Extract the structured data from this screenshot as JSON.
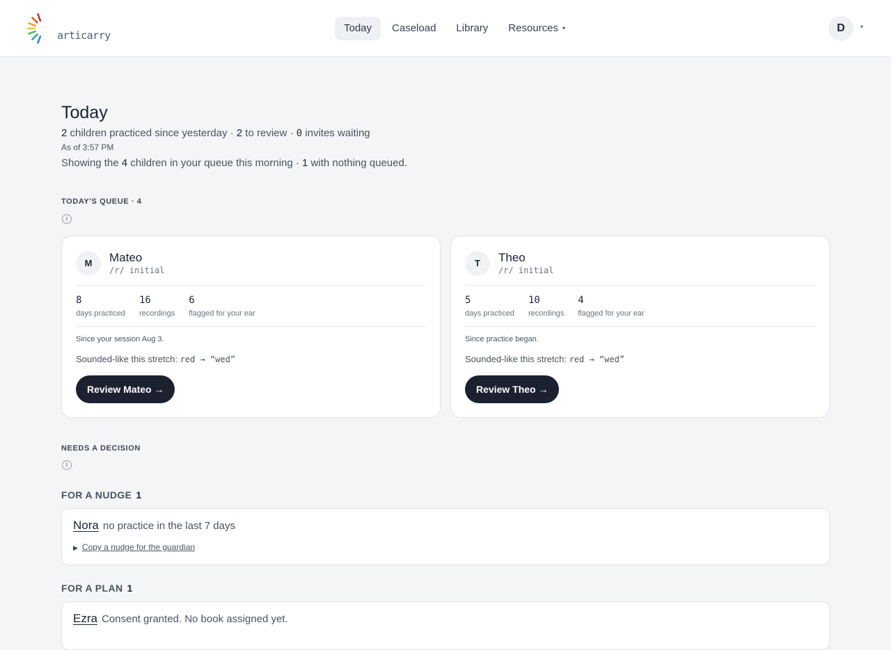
{
  "brand": {
    "name": "articarry",
    "ray_colors": [
      "#3b7ddd",
      "#2aa6a0",
      "#5bb85c",
      "#e7c93a",
      "#f29a2e",
      "#e2542c",
      "#c2272d"
    ]
  },
  "nav": {
    "items": [
      {
        "label": "Today",
        "active": true
      },
      {
        "label": "Caseload"
      },
      {
        "label": "Library"
      },
      {
        "label": "Resources"
      }
    ],
    "resources_caret": "▾",
    "user_initial": "D",
    "user_caret": "▾"
  },
  "page": {
    "title": "Today",
    "summary": {
      "practiced_count": "2",
      "practiced_text": " children practiced since yesterday · ",
      "review_count": "2",
      "review_text": " to review · ",
      "invites_count": "0",
      "invites_text": " invites waiting"
    },
    "as_of": "As of 3:57 PM",
    "showing": {
      "pre": "Showing the ",
      "count": "4",
      "mid": " children in your queue this morning · ",
      "nothing_count": "1",
      "post": " with nothing queued."
    }
  },
  "queue": {
    "label": "TODAY'S QUEUE · 4",
    "info_icon": "i",
    "cards": [
      {
        "initial": "M",
        "name": "Mateo",
        "target": "/r/ initial",
        "stats": [
          {
            "value": "8",
            "label": "days practiced"
          },
          {
            "value": "16",
            "label": "recordings"
          },
          {
            "value": "6",
            "label": "flagged for your ear"
          }
        ],
        "note": "Since your session Aug 3.",
        "sounded_label": "Sounded-like this stretch: ",
        "sounded_value": "red → “wed”",
        "button": "Review Mateo →"
      },
      {
        "initial": "T",
        "name": "Theo",
        "target": "/r/ initial",
        "stats": [
          {
            "value": "5",
            "label": "days practiced"
          },
          {
            "value": "10",
            "label": "recordings"
          },
          {
            "value": "4",
            "label": "flagged for your ear"
          }
        ],
        "note": "Since practice began.",
        "sounded_label": "Sounded-like this stretch: ",
        "sounded_value": "red → “wed”",
        "button": "Review Theo →"
      }
    ]
  },
  "decisions": {
    "label": "NEEDS A DECISION",
    "info_icon": "i",
    "nudge": {
      "heading": "FOR A NUDGE",
      "count": "1",
      "child": "Nora",
      "reason": "no practice in the last 7 days",
      "toggle_icon": "▶",
      "toggle_label": "Copy a nudge for the guardian"
    },
    "plan": {
      "heading": "FOR A PLAN",
      "count": "1",
      "child": "Ezra",
      "reason": "Consent granted. No book assigned yet."
    }
  }
}
